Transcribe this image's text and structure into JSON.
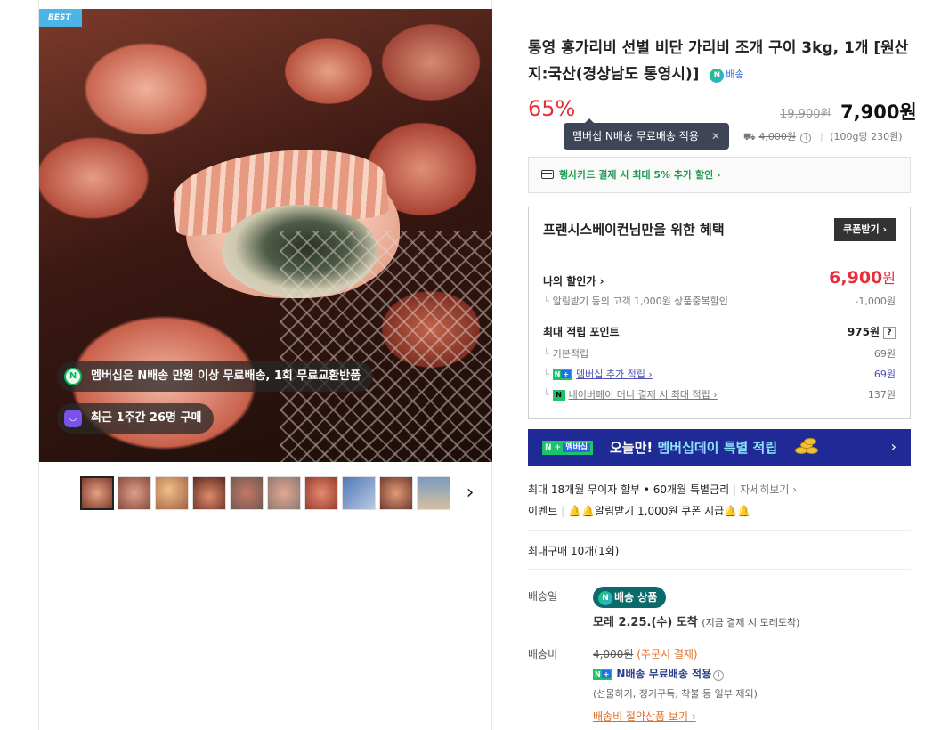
{
  "gallery": {
    "best_badge": "BEST",
    "membership_pill": "멤버십은 N배송 만원 이상 무료배송, 1회 무료교환반품",
    "membership_icon": "N",
    "recent_purchase_pill": "최근 1주간 26명 구매",
    "thumbnail_count": 10,
    "next_arrow": "›"
  },
  "product": {
    "title": "통영 홍가리비 선별 비단 가리비 조개 구이 3kg, 1개 [원산지:국산(경상남도 통영시)]",
    "n_delivery_badge": "배송",
    "n_icon": "N",
    "discount_rate": "65%",
    "original_price": "19,900원",
    "sale_price": "7,900원",
    "tooltip": "멤버십 N배송 무료배송 적용",
    "tooltip_close": "✕",
    "shipping_fee_strike": "4,000원",
    "unit_price": "(100g당 230원)"
  },
  "card_promo": "행사카드 결제 시 최대 5% 추가 할인 ›",
  "benefits": {
    "title": "프랜시스베이컨님만을 위한 혜택",
    "coupon_button": "쿠폰받기 ›",
    "my_price_label": "나의 할인가 ›",
    "my_price_value": "6,900",
    "my_price_unit": "원",
    "alarm_discount_label": "알림받기 동의 고객 1,000원 상품중복할인",
    "alarm_discount_value": "-1,000원",
    "points_label": "최대 적립 포인트",
    "points_value": "975원",
    "points_help": "?",
    "basic_points_label": "기본적립",
    "basic_points_value": "69원",
    "member_points_label": "멤버십 추가 적립 ›",
    "member_points_value": "69원",
    "npay_points_label": "네이버페이 머니 결제 시 최대 적립 ›",
    "npay_points_value": "137원"
  },
  "banner": {
    "badge_n": "N +",
    "badge_member": "멤버십",
    "text_white": "오늘만!",
    "text_blue": "멤버십데이 특별 적립",
    "arrow": "›"
  },
  "installment": {
    "text": "최대 18개월 무이자 할부 • 60개월 특별금리",
    "link": "자세히보기 ›"
  },
  "event": {
    "label": "이벤트",
    "text": "🔔🔔알림받기 1,000원 쿠폰 지급🔔🔔"
  },
  "max_purchase": "최대구매 10개(1회)",
  "delivery": {
    "date_label": "배송일",
    "badge": "배송 상품",
    "arrival": "모레 2.25.(수) 도착",
    "arrival_note": "(지금 결제 시 모레도착)",
    "fee_label": "배송비",
    "fee_strike": "4,000원",
    "fee_note": "(주문시 결제)",
    "free_label": "N배송 무료배송 적용",
    "exclusions": "(선물하기, 정기구독, 착불 등 일부 제외)",
    "saving_link": "배송비 절약상품 보기 ›"
  },
  "colors": {
    "discount_red": "#e5303b",
    "naver_green": "#1ec26b",
    "banner_navy": "#1f2a96",
    "badge_teal": "#0c6a6b"
  }
}
